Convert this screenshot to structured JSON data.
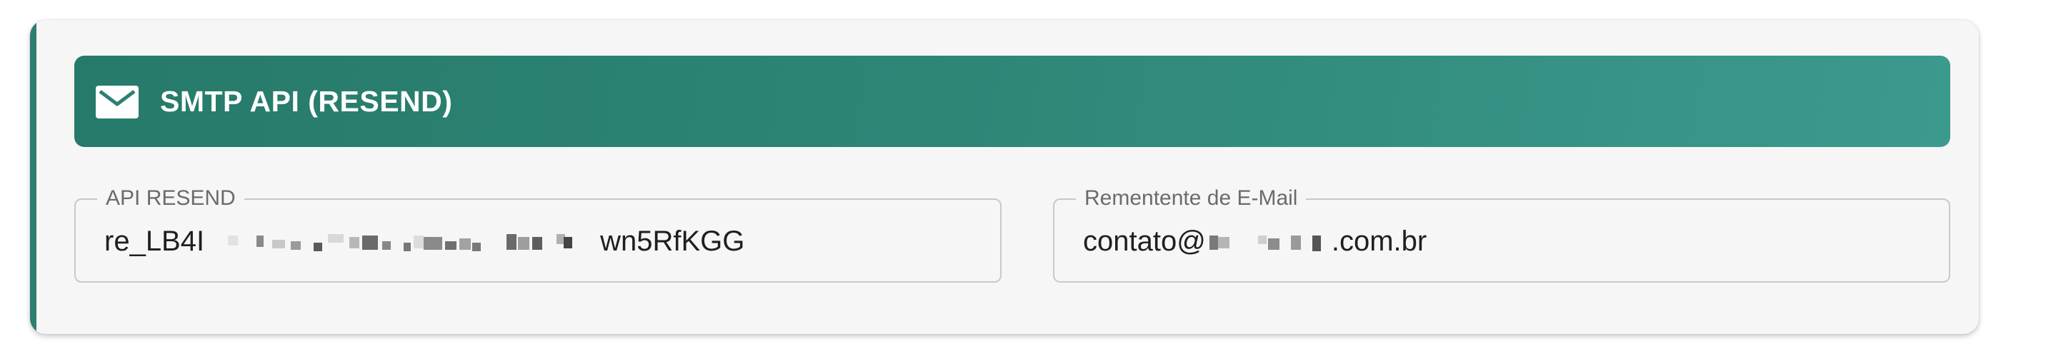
{
  "section": {
    "title": "SMTP API (RESEND)",
    "icon": "mail-icon",
    "accent_color": "#2d7e6f"
  },
  "fields": {
    "api_resend": {
      "label": "API RESEND",
      "value_prefix": "re_LB4I",
      "value_suffix": "wn5RfKGG"
    },
    "sender_email": {
      "label": "Rementente de E-Mail",
      "value_prefix": "contato@",
      "value_suffix": ".com.br"
    }
  }
}
